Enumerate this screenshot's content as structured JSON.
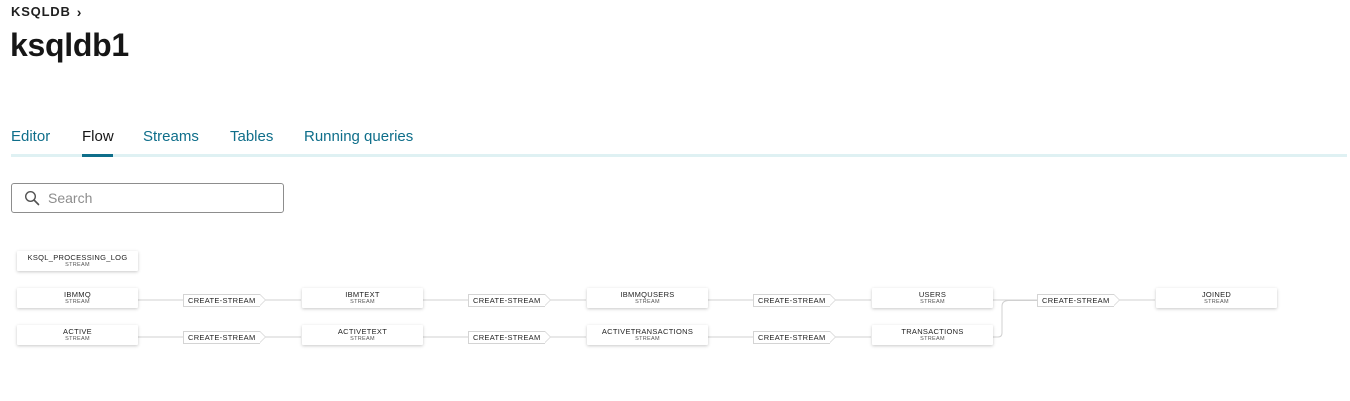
{
  "breadcrumb": {
    "label": "KSQLDB"
  },
  "page": {
    "title": "ksqldb1"
  },
  "tabs": [
    {
      "label": "Editor",
      "active": false
    },
    {
      "label": "Flow",
      "active": true
    },
    {
      "label": "Streams",
      "active": false
    },
    {
      "label": "Tables",
      "active": false
    },
    {
      "label": "Running queries",
      "active": false
    }
  ],
  "search": {
    "placeholder": "Search",
    "value": ""
  },
  "colors": {
    "accent": "#0e6e8a",
    "tab_track": "#dff1f3"
  },
  "flow": {
    "processing_log": {
      "name": "KSQL_PROCESSING_LOG",
      "type": "STREAM"
    },
    "row1": {
      "nodes": [
        {
          "name": "IBMMQ",
          "type": "STREAM"
        },
        {
          "name": "IBMTEXT",
          "type": "STREAM"
        },
        {
          "name": "IBMMQUSERS",
          "type": "STREAM"
        },
        {
          "name": "USERS",
          "type": "STREAM"
        },
        {
          "name": "JOINED",
          "type": "STREAM"
        }
      ],
      "ops": [
        "CREATE-STREAM",
        "CREATE-STREAM",
        "CREATE-STREAM",
        "CREATE-STREAM"
      ]
    },
    "row2": {
      "nodes": [
        {
          "name": "ACTIVE",
          "type": "STREAM"
        },
        {
          "name": "ACTIVETEXT",
          "type": "STREAM"
        },
        {
          "name": "ACTIVETRANSACTIONS",
          "type": "STREAM"
        },
        {
          "name": "TRANSACTIONS",
          "type": "STREAM"
        }
      ],
      "ops": [
        "CREATE-STREAM",
        "CREATE-STREAM",
        "CREATE-STREAM"
      ]
    }
  }
}
